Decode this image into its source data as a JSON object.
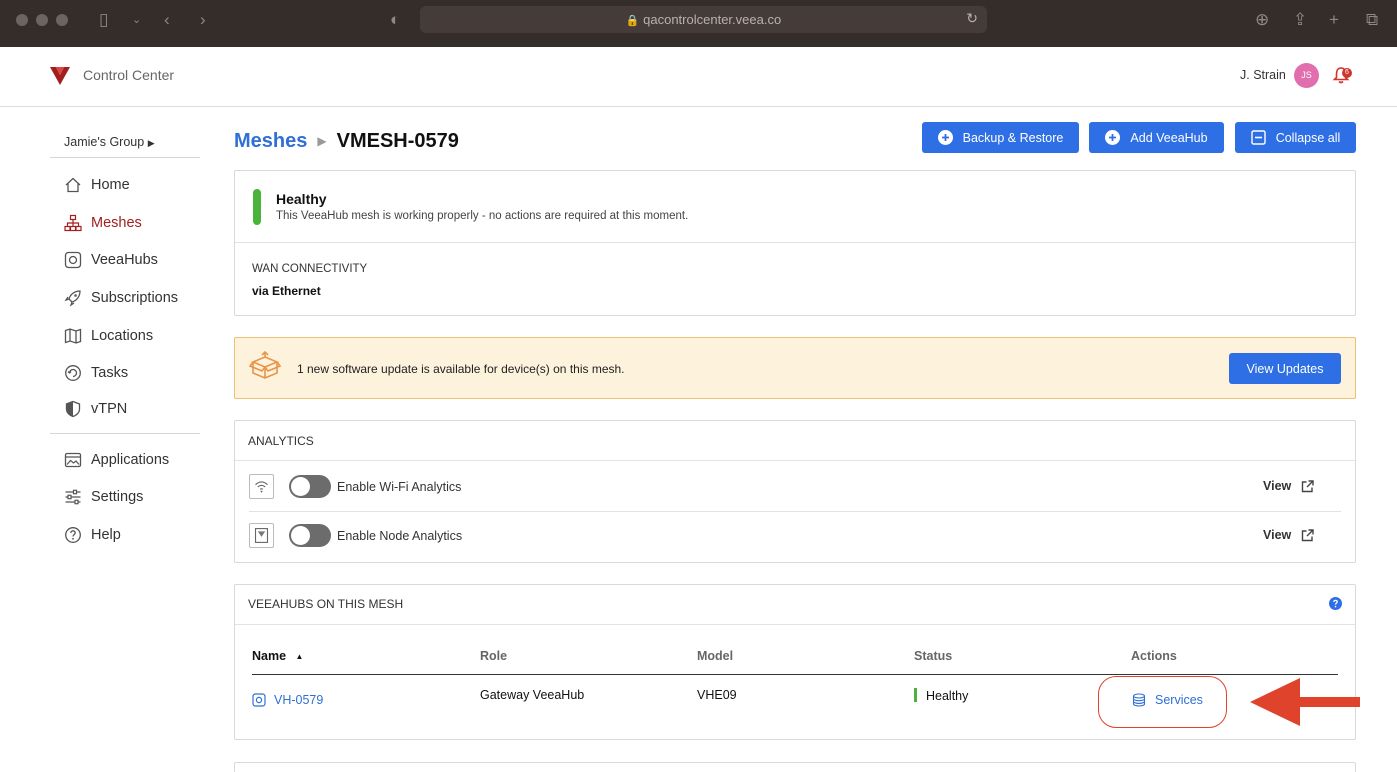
{
  "browser": {
    "url": "qacontrolcenter.veea.co",
    "icons": [
      "sidebar-icon",
      "chevron-down-icon",
      "back-icon",
      "forward-icon",
      "shield-icon",
      "lock-icon",
      "reload-icon",
      "download-icon",
      "share-icon",
      "new-tab-icon",
      "tabs-icon"
    ]
  },
  "header": {
    "app_title": "Control Center",
    "user_name": "J. Strain",
    "avatar_initials": "JS",
    "notification_count": "6"
  },
  "sidebar": {
    "group": "Jamie's Group",
    "items": [
      {
        "label": "Home",
        "icon": "home-icon"
      },
      {
        "label": "Meshes",
        "icon": "mesh-icon",
        "active": true
      },
      {
        "label": "VeeaHubs",
        "icon": "veeahub-icon"
      },
      {
        "label": "Subscriptions",
        "icon": "rocket-icon"
      },
      {
        "label": "Locations",
        "icon": "map-icon"
      },
      {
        "label": "Tasks",
        "icon": "tasks-icon"
      },
      {
        "label": "vTPN",
        "icon": "shield-icon"
      },
      {
        "label": "Applications",
        "icon": "applications-icon"
      },
      {
        "label": "Settings",
        "icon": "sliders-icon"
      },
      {
        "label": "Help",
        "icon": "help-icon"
      }
    ]
  },
  "breadcrumb": {
    "parent": "Meshes",
    "current": "VMESH-0579"
  },
  "toolbar": {
    "backup_label": "Backup & Restore",
    "add_label": "Add VeeaHub",
    "collapse_label": "Collapse all"
  },
  "health": {
    "title": "Healthy",
    "description": "This VeeaHub mesh is working properly - no actions are required at this moment.",
    "wan_label": "WAN CONNECTIVITY",
    "wan_value": "via Ethernet"
  },
  "update": {
    "message": "1 new software update is available for device(s) on this mesh.",
    "button_label": "View Updates"
  },
  "analytics": {
    "title": "ANALYTICS",
    "features": [
      {
        "label": "Enable Wi-Fi Analytics",
        "enabled": false,
        "view_label": "View",
        "icon": "wifi-icon"
      },
      {
        "label": "Enable Node Analytics",
        "enabled": false,
        "view_label": "View",
        "icon": "node-icon"
      }
    ]
  },
  "veeahubs": {
    "title": "VEEAHUBS ON THIS MESH",
    "columns": [
      "Name",
      "Role",
      "Model",
      "Status",
      "Actions"
    ],
    "rows": [
      {
        "name": "VH-0579",
        "role": "Gateway VeeaHub",
        "model": "VHE09",
        "status": "Healthy",
        "action": "Services"
      }
    ]
  },
  "colors": {
    "brand": "#a31f1f",
    "primary": "#2e6fe6",
    "healthy": "#4bb23a",
    "annotation": "#e0432c"
  }
}
